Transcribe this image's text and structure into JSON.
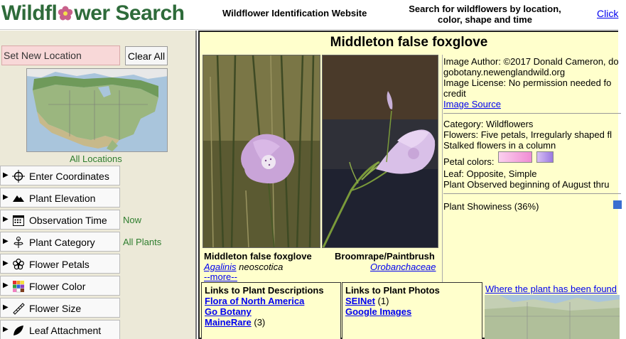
{
  "header": {
    "logo_left": "Wildfl",
    "logo_right": "wer Search",
    "tagline": "Wildflower Identification Website",
    "search_text": "Search for wildflowers by location, color, shape and time",
    "link": "Click"
  },
  "sidebar": {
    "set_location": "Set New Location",
    "clear_all": "Clear All",
    "all_locations": "All Locations",
    "filters": [
      {
        "label": "Enter Coordinates",
        "value": ""
      },
      {
        "label": "Plant Elevation",
        "value": ""
      },
      {
        "label": "Observation Time",
        "value": "Now"
      },
      {
        "label": "Plant Category",
        "value": "All Plants"
      },
      {
        "label": "Flower Petals",
        "value": ""
      },
      {
        "label": "Flower Color",
        "value": ""
      },
      {
        "label": "Flower Size",
        "value": ""
      },
      {
        "label": "Leaf Attachment",
        "value": ""
      }
    ]
  },
  "main": {
    "title": "Middleton false foxglove",
    "caption1_name": "Middleton false foxglove",
    "caption1_genus": "Agalinis",
    "caption1_species": " neoscotica",
    "more": "--more--",
    "caption2_name": "Broomrape/Paintbrush",
    "caption2_family": "Orobanchaceae",
    "info": {
      "author": "Image Author: ©2017 Donald Cameron, do",
      "site": "gobotany.newenglandwild.org",
      "license": "Image License: No permission needed fo",
      "credit": "credit",
      "source": "Image Source",
      "category": "Category: Wildflowers",
      "flowers": "Flowers: Five petals, Irregularly shaped fl",
      "stalked": "Stalked flowers in a column",
      "petal_colors": "Petal colors:",
      "leaf": "Leaf: Opposite, Simple",
      "observed": "Plant Observed beginning of August thru",
      "showiness": "Plant Showiness (36%)"
    },
    "descriptions": {
      "title": "Links to Plant Descriptions",
      "links": [
        "Flora of North America",
        "Go Botany",
        "MaineRare"
      ],
      "mainerare_count": "(3)"
    },
    "photos": {
      "title": "Links to Plant Photos",
      "links": [
        "SEINet",
        "Google Images"
      ],
      "seinet_count": "(1)"
    },
    "where": "Where the plant has been found"
  },
  "colors": {
    "logo_green": "#2e6b3a",
    "panel_yellow": "#ffffcc",
    "sidebar_bg": "#ece9d8",
    "petal_pink": "#f4a8e0",
    "petal_violet": "#b89ae8"
  }
}
